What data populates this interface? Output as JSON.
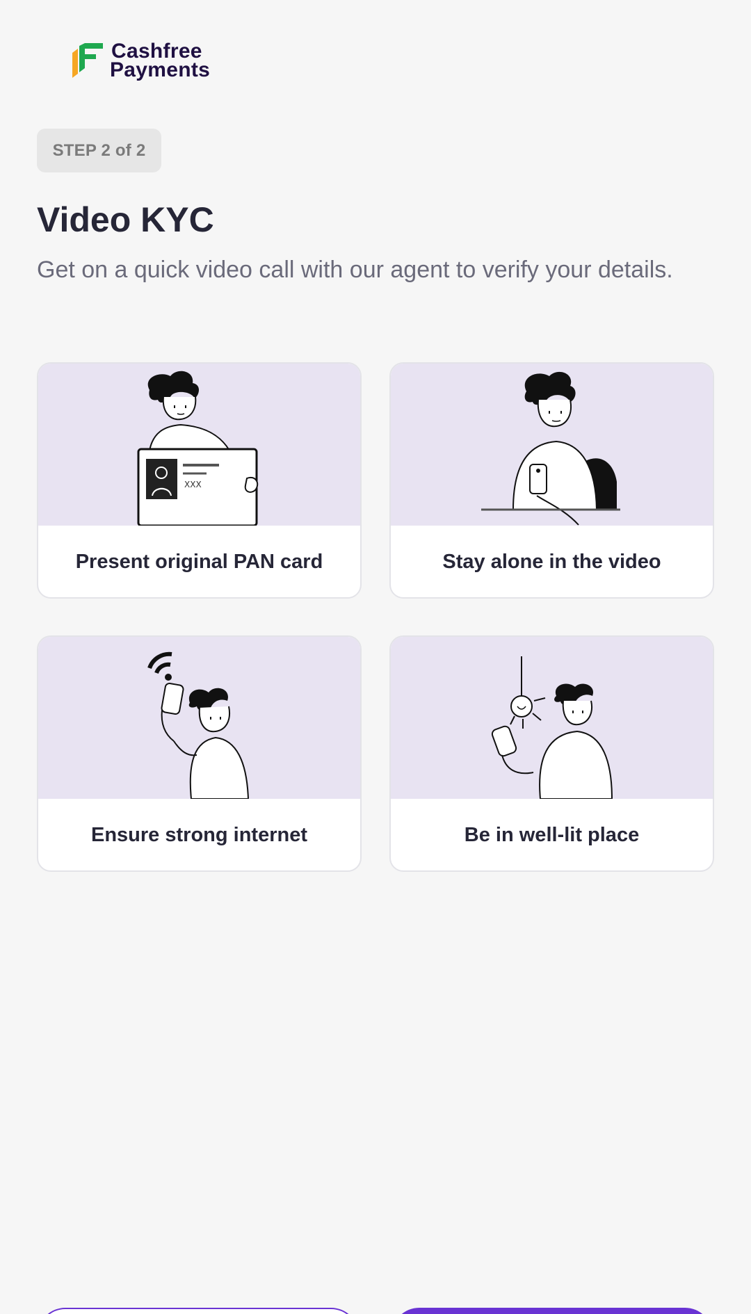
{
  "brand": {
    "line1": "Cashfree",
    "line2": "Payments",
    "colors": {
      "green": "#1fa84f",
      "orange": "#f6a623",
      "navy": "#1f1042"
    }
  },
  "step": {
    "label": "STEP 2 of 2"
  },
  "header": {
    "title": "Video KYC",
    "subtitle": "Get on a quick video call with our agent to verify your details."
  },
  "cards": [
    {
      "label": "Present original PAN card",
      "icon": "pan-card-illustration"
    },
    {
      "label": "Stay alone in the video",
      "icon": "alone-illustration"
    },
    {
      "label": "Ensure strong internet",
      "icon": "wifi-illustration"
    },
    {
      "label": "Be in well-lit place",
      "icon": "bulb-illustration"
    }
  ],
  "actions": {
    "secondary_color": "#6933d3",
    "primary_color": "#6933d3"
  }
}
